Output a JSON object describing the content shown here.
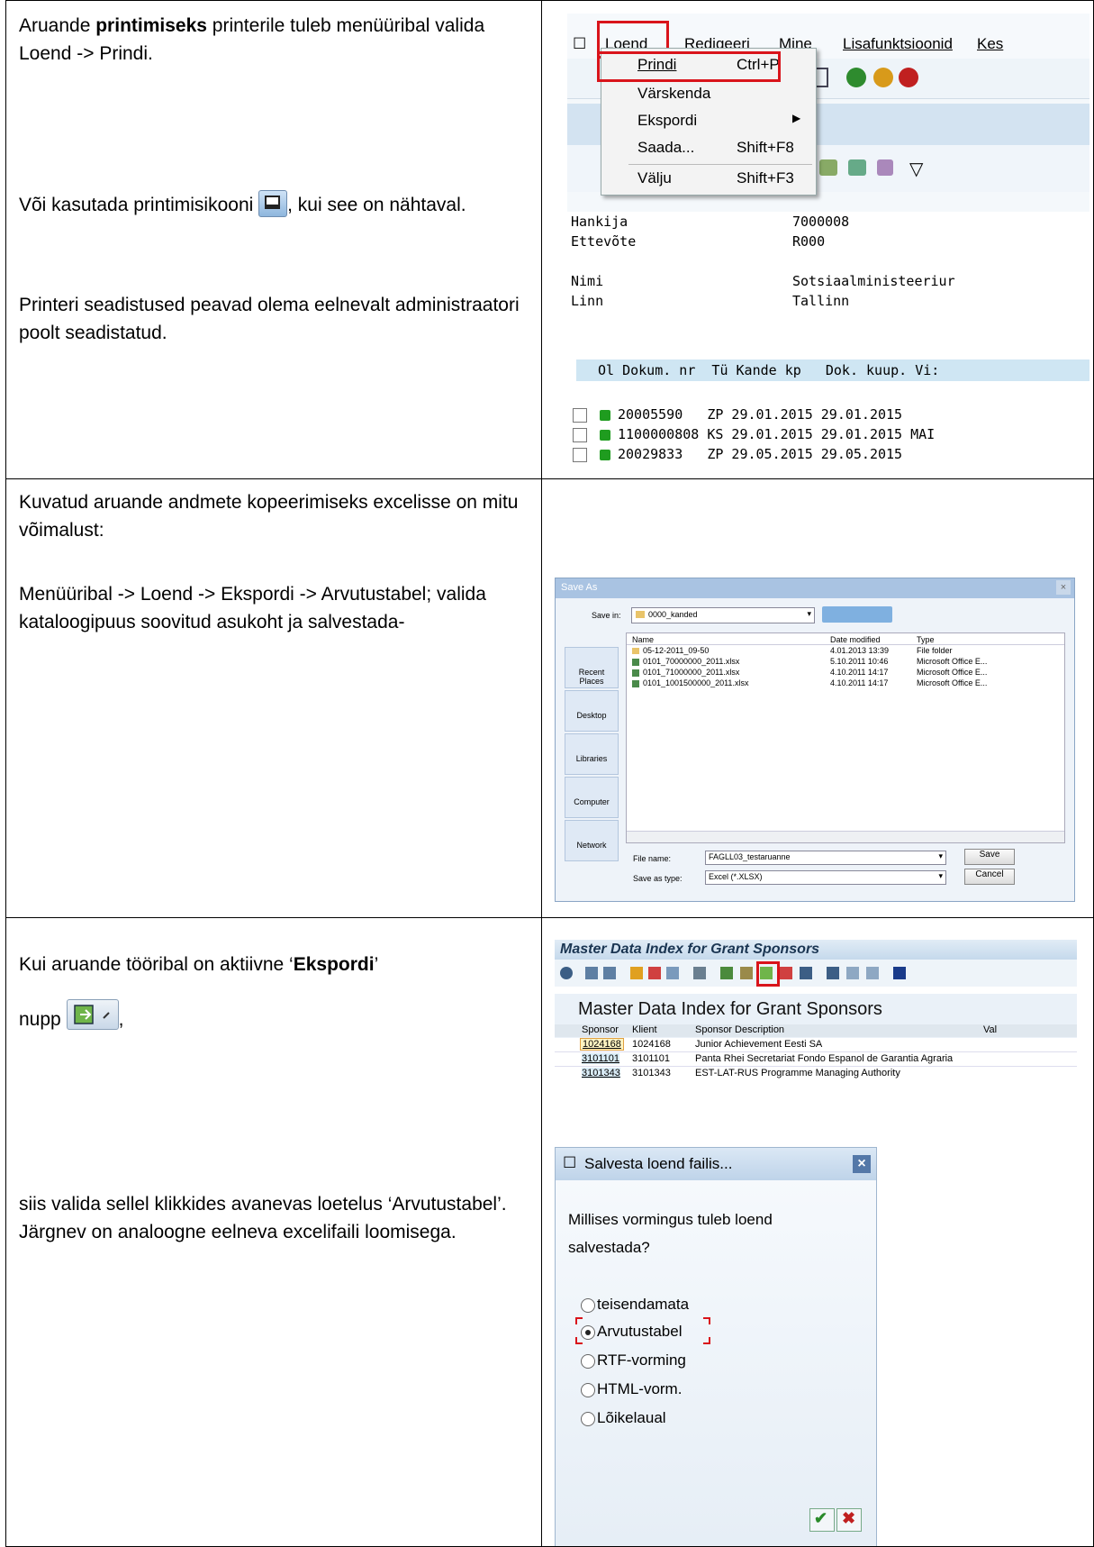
{
  "rows": [
    {
      "text": {
        "p1_pre": "Aruande ",
        "p1_bold": "printimiseks",
        "p1_post": " printerile  tuleb menüüribal valida Loend -> Prindi.",
        "p2_pre": "Või  kasutada printimisikooni ",
        "p2_post": ", kui see on nähtaval.",
        "p3": "Printeri seadistused peavad olema eelnevalt administraatori poolt seadistatud."
      },
      "screenshot": {
        "menu": [
          "Loend",
          "Redigeeri",
          "Mine",
          "Lisafunktsioonid",
          "Kes"
        ],
        "dropdown": [
          {
            "label": "Prindi",
            "shortcut": "Ctrl+P"
          },
          {
            "label": "Värskenda",
            "shortcut": ""
          },
          {
            "label": "Ekspordi",
            "shortcut": "▶"
          },
          {
            "label": "Saada...",
            "shortcut": "Shift+F8"
          },
          {
            "label": "Välju",
            "shortcut": "Shift+F3"
          }
        ],
        "fields": [
          {
            "label": "Hankija",
            "value": "7000008"
          },
          {
            "label": "Ettevõte",
            "value": "R000"
          },
          {
            "label": "Nimi",
            "value": "Sotsiaalministeeriur"
          },
          {
            "label": "Linn",
            "value": "Tallinn"
          }
        ],
        "table_header": "Ol Dokum. nr  Tü Kande kp   Dok. kuup. Vi:",
        "table_rows": [
          "20005590   ZP 29.01.2015 29.01.2015",
          "1100000808 KS 29.01.2015 29.01.2015 MAI",
          "20029833   ZP 29.05.2015 29.05.2015"
        ]
      }
    },
    {
      "text": {
        "p1": "Kuvatud aruande andmete kopeerimiseks excelisse on mitu võimalust:",
        "p2": "Menüüribal -> Loend  -> Ekspordi  -> Arvutustabel; valida kataloogipuus soovitud asukoht ja salvestada-"
      },
      "screenshot": {
        "title": "Save As",
        "save_in_label": "Save in:",
        "save_in_value": "0000_kanded",
        "places": [
          "Recent Places",
          "Desktop",
          "Libraries",
          "Computer",
          "Network"
        ],
        "columns": [
          "Name",
          "Date modified",
          "Type"
        ],
        "files": [
          {
            "name": "05-12-2011_09-50",
            "date": "4.01.2013 13:39",
            "type": "File folder"
          },
          {
            "name": "0101_70000000_2011.xlsx",
            "date": "5.10.2011 10:46",
            "type": "Microsoft Office E..."
          },
          {
            "name": "0101_71000000_2011.xlsx",
            "date": "4.10.2011 14:17",
            "type": "Microsoft Office E..."
          },
          {
            "name": "0101_1001500000_2011.xlsx",
            "date": "4.10.2011 14:17",
            "type": "Microsoft Office E..."
          }
        ],
        "file_name_label": "File name:",
        "file_name_value": "FAGLL03_testaruanne",
        "save_type_label": "Save as type:",
        "save_type_value": "Excel (*.XLSX)",
        "save_button": "Save",
        "cancel_button": "Cancel"
      }
    },
    {
      "text": {
        "p1_pre": "Kui aruande tööribal on aktiivne ‘",
        "p1_bold": "Ekspordi",
        "p1_post": "’",
        "p2_pre": "nupp ",
        "p2_post": ",",
        "p3": "siis valida sellel klikkides avanevas loetelus ‘Arvutustabel’.  Järgnev on analoogne eelneva excelifaili loomisega."
      },
      "master": {
        "title": "Master Data Index for Grant Sponsors",
        "heading": "Master Data Index for Grant Sponsors",
        "columns": [
          "Sponsor",
          "Klient",
          "Sponsor Description",
          "Val"
        ],
        "rows": [
          {
            "sponsor": "1024168",
            "klient": "1024168",
            "desc": "Junior Achievement Eesti SA"
          },
          {
            "sponsor": "3101101",
            "klient": "3101101",
            "desc": "Panta Rhei Secretariat Fondo Espanol de Garantia Agraria"
          },
          {
            "sponsor": "3101343",
            "klient": "3101343",
            "desc": "EST-LAT-RUS Programme Managing Authority"
          }
        ]
      },
      "dialog": {
        "title": "Salvesta loend failis...",
        "question": "Millises vormingus tuleb loend salvestada?",
        "options": [
          "teisendamata",
          "Arvutustabel",
          "RTF-vorming",
          "HTML-vorm.",
          "Lõikelaual"
        ],
        "selected": "Arvutustabel"
      }
    }
  ]
}
